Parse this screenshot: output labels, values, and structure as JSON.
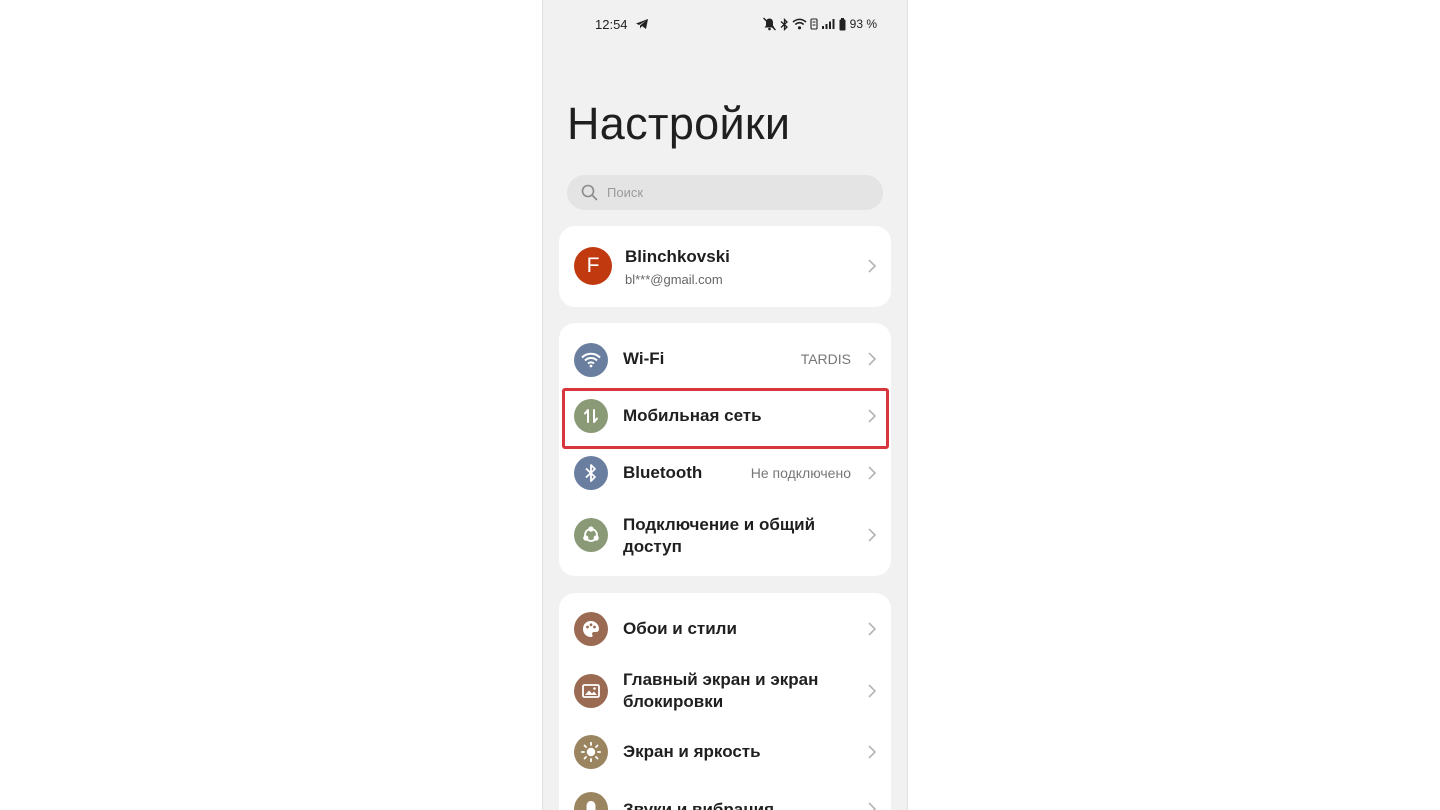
{
  "status_bar": {
    "time": "12:54",
    "battery": "93 %"
  },
  "page": {
    "title": "Настройки"
  },
  "search": {
    "placeholder": "Поиск"
  },
  "account": {
    "avatar_letter": "F",
    "avatar_color": "#c0390f",
    "name": "Blinchkovski",
    "email": "bl***@gmail.com"
  },
  "network_group": [
    {
      "label": "Wi-Fi",
      "value": "TARDIS",
      "icon": "wifi-icon",
      "color": "#6a7fa0"
    },
    {
      "label": "Мобильная сеть",
      "value": "",
      "icon": "mobile-data-icon",
      "color": "#8a9a76",
      "highlighted": true
    },
    {
      "label": "Bluetooth",
      "value": "Не подключено",
      "icon": "bluetooth-icon",
      "color": "#6a7fa0"
    },
    {
      "label": "Подключение и общий доступ",
      "value": "",
      "icon": "share-icon",
      "color": "#8a9a76"
    }
  ],
  "display_group": [
    {
      "label": "Обои и стили",
      "icon": "palette-icon",
      "color": "#9a6b52"
    },
    {
      "label": "Главный экран и экран блокировки",
      "icon": "image-icon",
      "color": "#9a6b52"
    },
    {
      "label": "Экран и яркость",
      "icon": "brightness-icon",
      "color": "#9a8560"
    },
    {
      "label": "Звуки и вибрация",
      "icon": "bell-icon",
      "color": "#9a8560"
    }
  ],
  "highlight_color": "#d9353d"
}
